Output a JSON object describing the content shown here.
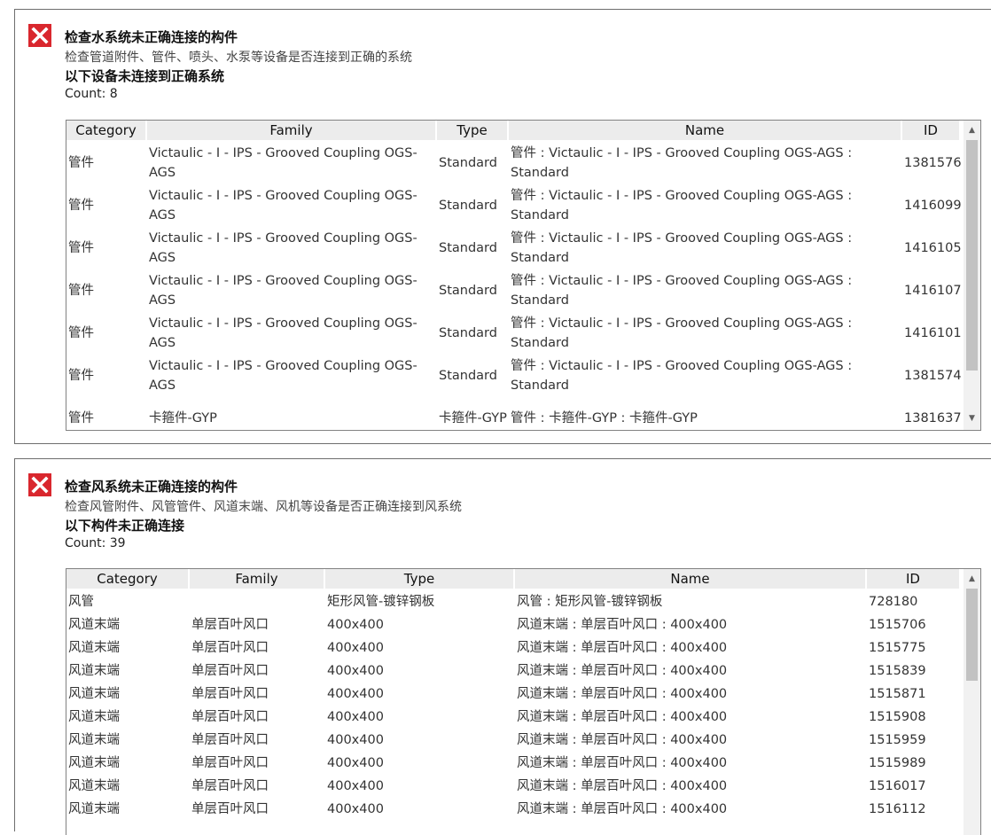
{
  "panels": [
    {
      "title": "检查水系统未正确连接的构件",
      "description": "检查管道附件、管件、喷头、水泵等设备是否连接到正确的系统",
      "subtitle": "以下设备未连接到正确系统",
      "count": "Count: 8",
      "columns": [
        "Category",
        "Family",
        "Type",
        "Name",
        "ID"
      ],
      "rows": [
        {
          "category": "管件",
          "family": "Victaulic - I - IPS - Grooved Coupling OGS-AGS",
          "type": "Standard",
          "name": "管件 : Victaulic - I - IPS - Grooved Coupling OGS-AGS : Standard",
          "id": "1381576"
        },
        {
          "category": "管件",
          "family": "Victaulic - I - IPS - Grooved Coupling OGS-AGS",
          "type": "Standard",
          "name": "管件 : Victaulic - I - IPS - Grooved Coupling OGS-AGS : Standard",
          "id": "1416099"
        },
        {
          "category": "管件",
          "family": "Victaulic - I - IPS - Grooved Coupling OGS-AGS",
          "type": "Standard",
          "name": "管件 : Victaulic - I - IPS - Grooved Coupling OGS-AGS : Standard",
          "id": "1416105"
        },
        {
          "category": "管件",
          "family": "Victaulic - I - IPS - Grooved Coupling OGS-AGS",
          "type": "Standard",
          "name": "管件 : Victaulic - I - IPS - Grooved Coupling OGS-AGS : Standard",
          "id": "1416107"
        },
        {
          "category": "管件",
          "family": "Victaulic - I - IPS - Grooved Coupling OGS-AGS",
          "type": "Standard",
          "name": "管件 : Victaulic - I - IPS - Grooved Coupling OGS-AGS : Standard",
          "id": "1416101"
        },
        {
          "category": "管件",
          "family": "Victaulic - I - IPS - Grooved Coupling OGS-AGS",
          "type": "Standard",
          "name": "管件 : Victaulic - I - IPS - Grooved Coupling OGS-AGS : Standard",
          "id": "1381574"
        },
        {
          "category": "管件",
          "family": "卡箍件-GYP",
          "type": "卡箍件-GYP",
          "name": "管件 : 卡箍件-GYP : 卡箍件-GYP",
          "id": "1381637"
        }
      ]
    },
    {
      "title": "检查风系统未正确连接的构件",
      "description": "检查风管附件、风管管件、风道末端、风机等设备是否正确连接到风系统",
      "subtitle": "以下构件未正确连接",
      "count": "Count: 39",
      "columns": [
        "Category",
        "Family",
        "Type",
        "Name",
        "ID"
      ],
      "rows": [
        {
          "category": "风管",
          "family": "",
          "type": "矩形风管-镀锌钢板",
          "name": "风管 : 矩形风管-镀锌钢板",
          "id": "728180"
        },
        {
          "category": "风道末端",
          "family": "单层百叶风口",
          "type": "400x400",
          "name": "风道末端 : 单层百叶风口 : 400x400",
          "id": "1515706"
        },
        {
          "category": "风道末端",
          "family": "单层百叶风口",
          "type": "400x400",
          "name": "风道末端 : 单层百叶风口 : 400x400",
          "id": "1515775"
        },
        {
          "category": "风道末端",
          "family": "单层百叶风口",
          "type": "400x400",
          "name": "风道末端 : 单层百叶风口 : 400x400",
          "id": "1515839"
        },
        {
          "category": "风道末端",
          "family": "单层百叶风口",
          "type": "400x400",
          "name": "风道末端 : 单层百叶风口 : 400x400",
          "id": "1515871"
        },
        {
          "category": "风道末端",
          "family": "单层百叶风口",
          "type": "400x400",
          "name": "风道末端 : 单层百叶风口 : 400x400",
          "id": "1515908"
        },
        {
          "category": "风道末端",
          "family": "单层百叶风口",
          "type": "400x400",
          "name": "风道末端 : 单层百叶风口 : 400x400",
          "id": "1515959"
        },
        {
          "category": "风道末端",
          "family": "单层百叶风口",
          "type": "400x400",
          "name": "风道末端 : 单层百叶风口 : 400x400",
          "id": "1515989"
        },
        {
          "category": "风道末端",
          "family": "单层百叶风口",
          "type": "400x400",
          "name": "风道末端 : 单层百叶风口 : 400x400",
          "id": "1516017"
        },
        {
          "category": "风道末端",
          "family": "单层百叶风口",
          "type": "400x400",
          "name": "风道末端 : 单层百叶风口 : 400x400",
          "id": "1516112"
        }
      ]
    }
  ],
  "icons": {
    "error": "close-x-icon",
    "scroll_up": "chevron-up-icon",
    "scroll_down": "chevron-down-icon"
  },
  "colors": {
    "error_red": "#d9272e",
    "header_bg": "#ececec",
    "scrollbar_thumb": "#c2c2c2"
  }
}
